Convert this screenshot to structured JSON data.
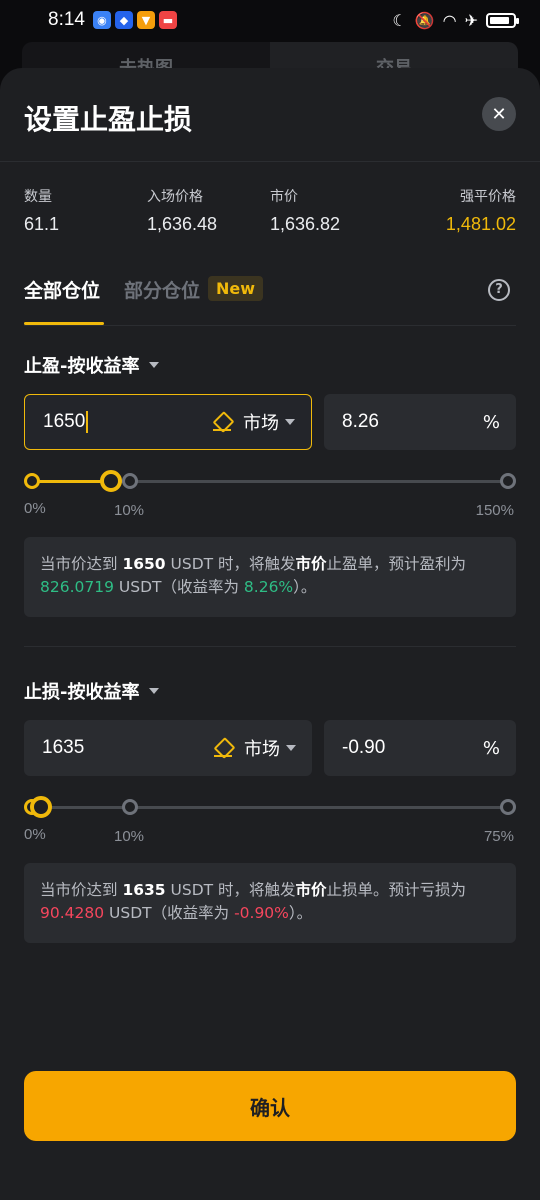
{
  "status": {
    "time": "8:14"
  },
  "background_tabs": [
    "未热图",
    "交易"
  ],
  "sheet": {
    "title": "设置止盈止损"
  },
  "stats": [
    {
      "label": "数量",
      "value": "61.1"
    },
    {
      "label": "入场价格",
      "value": "1,636.48"
    },
    {
      "label": "市价",
      "value": "1,636.82"
    },
    {
      "label": "强平价格",
      "value": "1,481.02"
    }
  ],
  "tabs": {
    "all": "全部仓位",
    "partial": "部分仓位",
    "new_badge": "New"
  },
  "take_profit": {
    "label": "止盈-按收益率",
    "price": "1650",
    "order_type": "市场",
    "percent": "8.26",
    "percent_sign": "%",
    "slider": {
      "value_pct": 10,
      "max_pct": 150,
      "ticks": [
        "0%",
        "10%",
        "150%"
      ]
    },
    "note": {
      "p1": "当市价达到 ",
      "price": "1650",
      "p2": " USDT 时，将触发",
      "type": "市价",
      "p3": "止盈单，预计盈利为",
      "amount": "826.0719",
      "p4": " USDT（收益率为 ",
      "rate": "8.26%",
      "p5": "）。"
    }
  },
  "stop_loss": {
    "label": "止损-按收益率",
    "price": "1635",
    "order_type": "市场",
    "percent": "-0.90",
    "percent_sign": "%",
    "slider": {
      "value_pct": 0.9,
      "max_pct": 75,
      "ticks": [
        "0%",
        "10%",
        "75%"
      ]
    },
    "note": {
      "p1": "当市价达到 ",
      "price": "1635",
      "p2": " USDT 时，将触发",
      "type": "市价",
      "p3": "止损单。预计亏损为",
      "amount": "90.4280",
      "p4": " USDT（收益率为 ",
      "rate": "-0.90%",
      "p5": "）。"
    }
  },
  "confirm_label": "确认",
  "colors": {
    "accent": "#f0b90b",
    "profit": "#2ebd85",
    "loss": "#f6465d",
    "button": "#f7a600"
  }
}
